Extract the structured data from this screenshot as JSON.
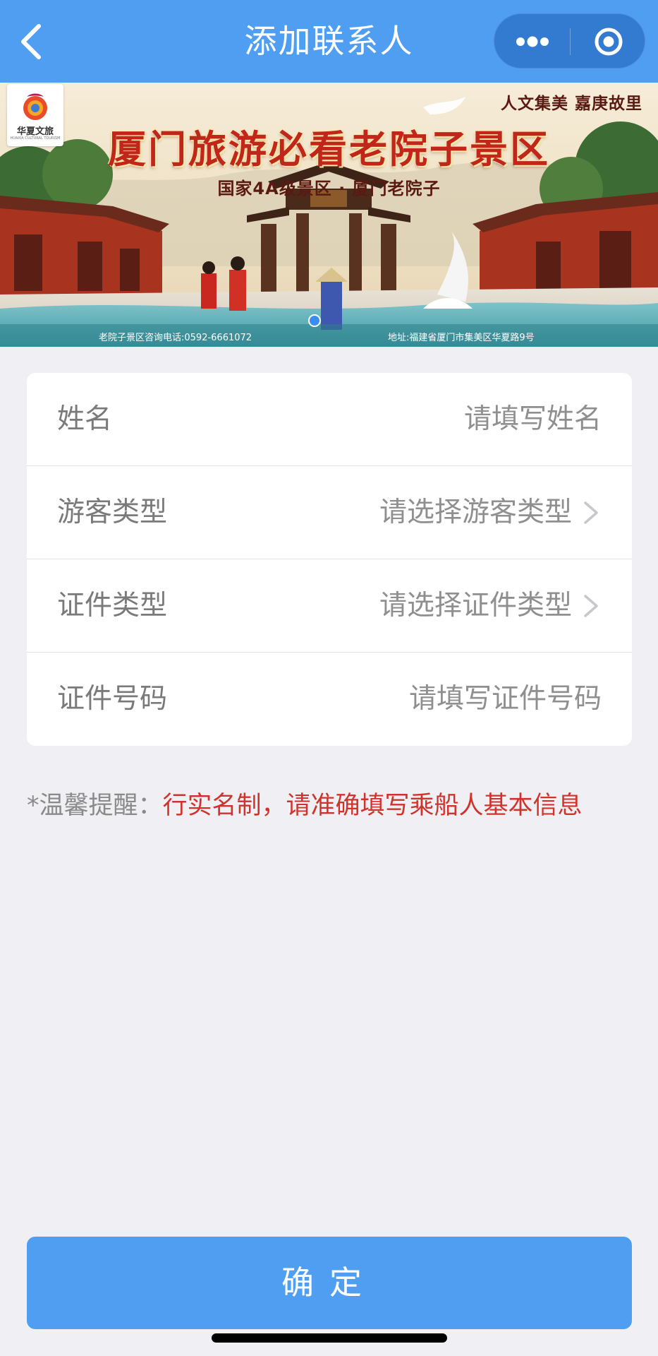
{
  "navbar": {
    "title": "添加联系人",
    "back_icon": "chevron-left-icon",
    "more_icon": "more-dots-icon",
    "close_icon": "target-circle-icon",
    "background_color": "#4f9ef1"
  },
  "banner": {
    "logo_text": "华夏文旅",
    "logo_subtext": "HUAXIA CULTURAL TOURISM",
    "slogan": "人文集美 嘉庚故里",
    "headline": "厦门旅游必看老院子景区",
    "subheadline": "国家4A级景区 · 厦门老院子",
    "phone": "老院子景区咨询电话:0592-6661072",
    "address": "地址:福建省厦门市集美区华夏路9号",
    "carousel_active_index": 1
  },
  "form": {
    "rows": [
      {
        "label": "姓名",
        "placeholder": "请填写姓名",
        "has_chevron": false
      },
      {
        "label": "游客类型",
        "placeholder": "请选择游客类型",
        "has_chevron": true
      },
      {
        "label": "证件类型",
        "placeholder": "请选择证件类型",
        "has_chevron": true
      },
      {
        "label": "证件号码",
        "placeholder": "请填写证件号码",
        "has_chevron": false
      }
    ]
  },
  "reminder": {
    "label": "*温馨提醒：",
    "text": "行实名制，请准确填写乘船人基本信息",
    "text_color": "#d0332b"
  },
  "confirm": {
    "label": "确定",
    "background_color": "#4f9ef1"
  }
}
